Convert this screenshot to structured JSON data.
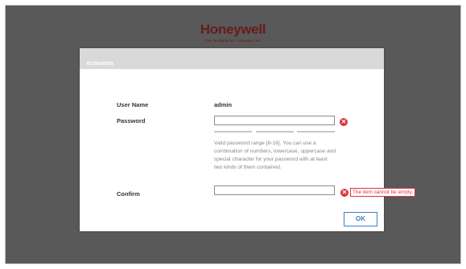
{
  "brand": {
    "name": "Honeywell",
    "tagline": "THE POWER OF CONNECTED"
  },
  "dialog": {
    "title": "Activation",
    "username_label": "User Name",
    "username_value": "admin",
    "password_label": "Password",
    "password_value": "",
    "password_hint": "Valid password range [8-16]. You can use a combination of numbers, lowercase, uppercase and special character for your password with at least two kinds of them contained.",
    "confirm_label": "Confirm",
    "confirm_value": "",
    "confirm_error": "The item cannot be empty.",
    "ok_label": "OK",
    "error_icon_glyph": "✕",
    "colors": {
      "error": "#d9343a",
      "accent": "#3b7fc4",
      "brand": "#6a1a1a"
    }
  }
}
